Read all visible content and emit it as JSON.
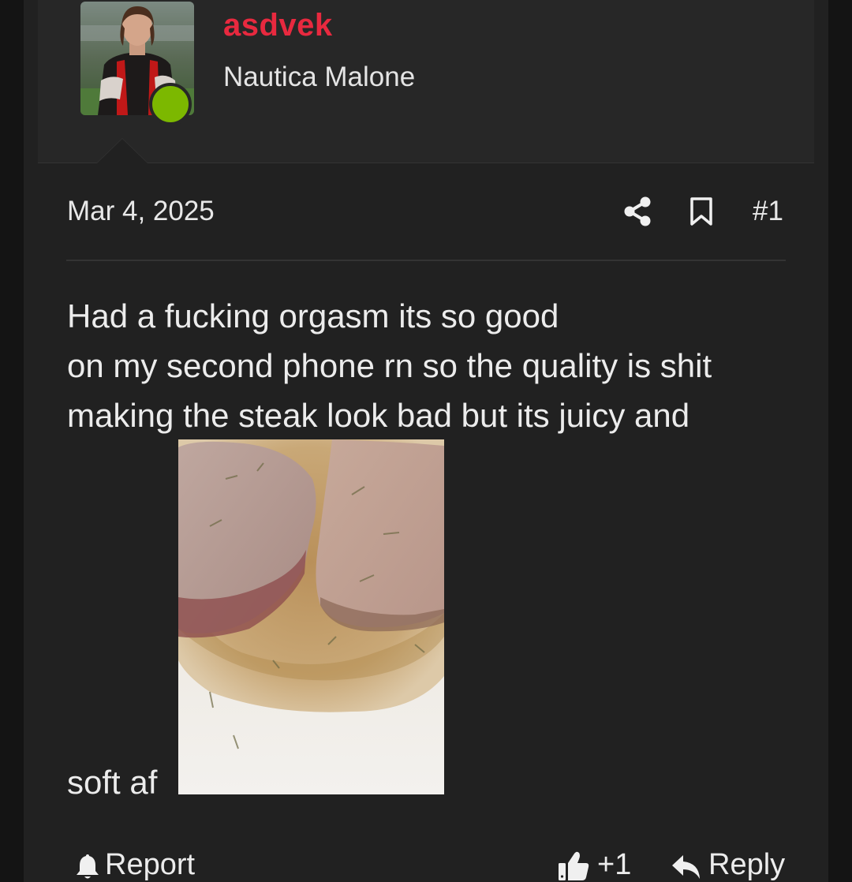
{
  "user": {
    "username": "asdvek",
    "title": "Nautica Malone",
    "avatar_icon": "user-avatar-photo",
    "online_status_color": "#7cb800",
    "username_color": "#e8293f"
  },
  "post": {
    "date": "Mar 4, 2025",
    "number": "#1",
    "share_icon": "share-icon",
    "bookmark_icon": "bookmark-icon",
    "body": {
      "line1": "Had a fucking orgasm its so good",
      "line2": "on my second phone rn so the quality is shit",
      "line3": "making the steak look bad but its juicy and",
      "line4": "soft af"
    },
    "image_icon": "steak-photo"
  },
  "footer": {
    "report_label": "Report",
    "like_count": "+1",
    "reply_label": "Reply"
  }
}
